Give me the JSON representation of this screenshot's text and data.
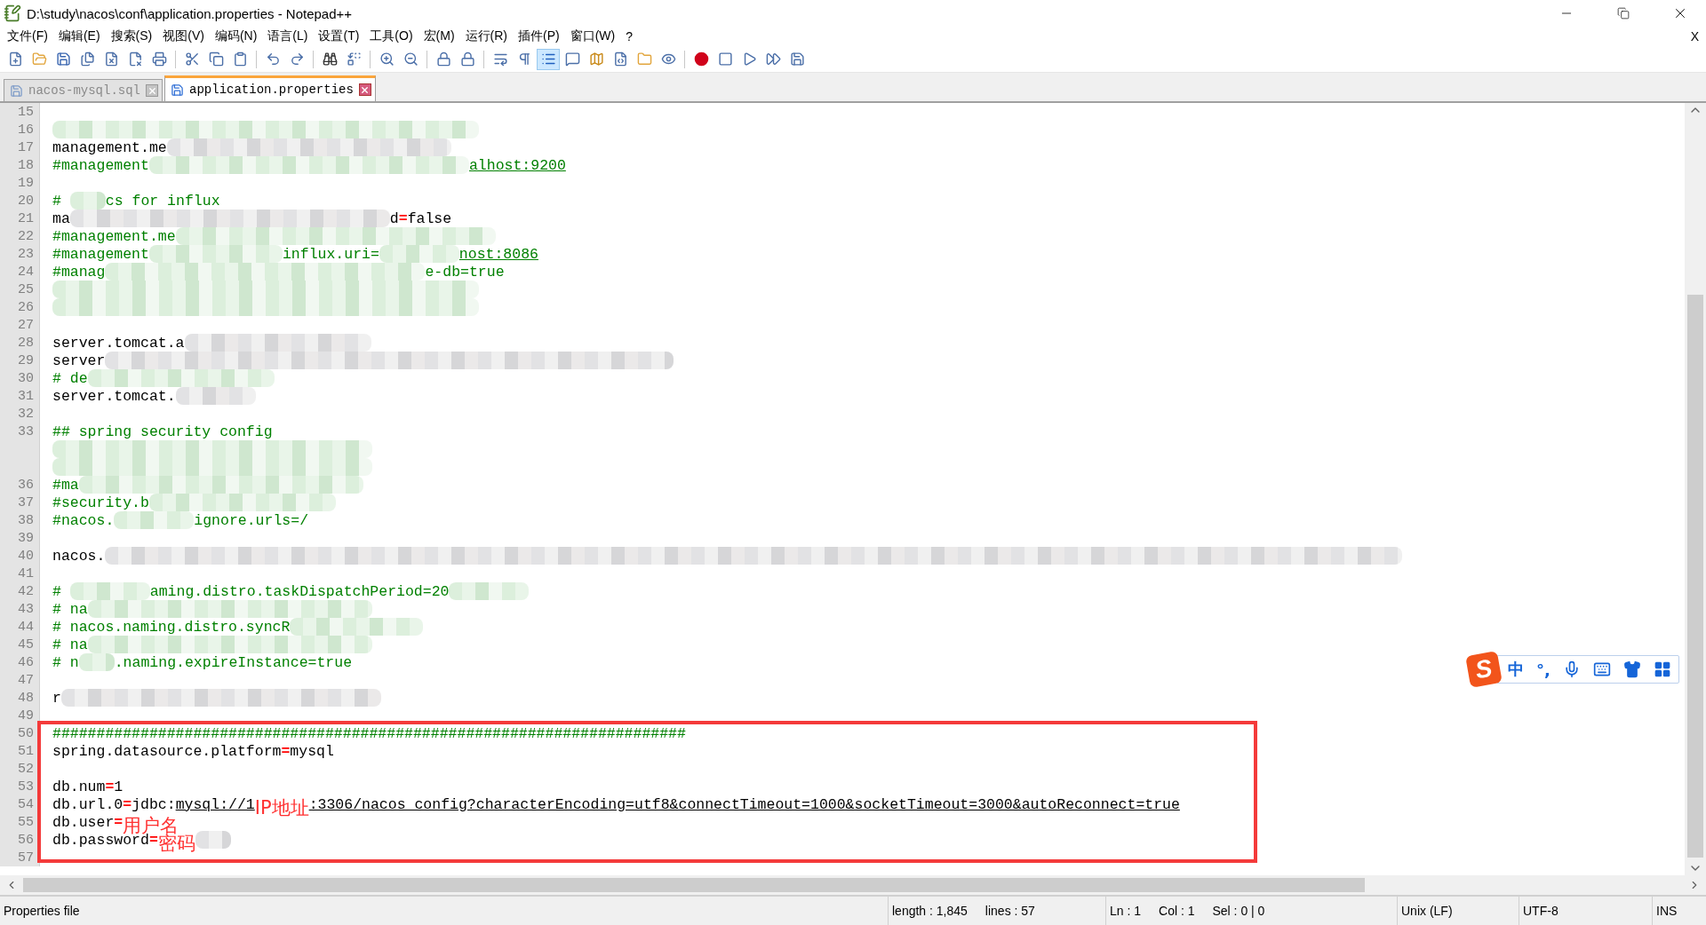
{
  "window": {
    "title": "D:\\study\\nacos\\conf\\application.properties - Notepad++"
  },
  "menu": {
    "items": [
      "文件(F)",
      "编辑(E)",
      "搜索(S)",
      "视图(V)",
      "编码(N)",
      "语言(L)",
      "设置(T)",
      "工具(O)",
      "宏(M)",
      "运行(R)",
      "插件(P)",
      "窗口(W)",
      "?"
    ],
    "close": "X"
  },
  "toolbar": {
    "indent_guide_on": true
  },
  "tabs": [
    {
      "label": "nacos-mysql.sql",
      "selected": false
    },
    {
      "label": "application.properties",
      "selected": true
    }
  ],
  "lines": [
    {
      "number": "15"
    },
    {
      "number": "16",
      "segments": [
        {
          "kind": "blur"
        }
      ]
    },
    {
      "number": "17",
      "segments": [
        {
          "kind": "text",
          "text": "management.me"
        },
        {
          "kind": "blur"
        }
      ]
    },
    {
      "number": "18",
      "segments": [
        {
          "kind": "comment",
          "text": "#management"
        },
        {
          "kind": "blur"
        },
        {
          "kind": "comment-link",
          "text": "alhost:9200"
        }
      ]
    },
    {
      "number": "19"
    },
    {
      "number": "20",
      "segments": [
        {
          "kind": "comment",
          "text": "# "
        },
        {
          "kind": "blur"
        },
        {
          "kind": "comment",
          "text": "cs for influx"
        }
      ]
    },
    {
      "number": "21",
      "segments": [
        {
          "kind": "text",
          "text": "ma"
        },
        {
          "kind": "blur"
        },
        {
          "kind": "text",
          "text": "d"
        },
        {
          "kind": "op",
          "text": "="
        },
        {
          "kind": "text",
          "text": "false"
        }
      ]
    },
    {
      "number": "22",
      "segments": [
        {
          "kind": "comment",
          "text": "#management.me"
        },
        {
          "kind": "blur"
        }
      ]
    },
    {
      "number": "23",
      "segments": [
        {
          "kind": "comment",
          "text": "#management"
        },
        {
          "kind": "blur"
        },
        {
          "kind": "comment",
          "text": "influx.uri="
        },
        {
          "kind": "blur"
        },
        {
          "kind": "comment-link",
          "text": "nost:8086"
        }
      ]
    },
    {
      "number": "24",
      "segments": [
        {
          "kind": "comment",
          "text": "#manag"
        },
        {
          "kind": "blur"
        },
        {
          "kind": "comment",
          "text": "e-db=true"
        }
      ]
    },
    {
      "number": "25",
      "segments": [
        {
          "kind": "blur"
        }
      ]
    },
    {
      "number": "26",
      "segments": [
        {
          "kind": "blur"
        }
      ]
    },
    {
      "number": "27"
    },
    {
      "number": "28",
      "segments": [
        {
          "kind": "text",
          "text": "server.tomcat.a"
        },
        {
          "kind": "blur"
        }
      ]
    },
    {
      "number": "29",
      "segments": [
        {
          "kind": "text",
          "text": "server"
        },
        {
          "kind": "blur"
        }
      ]
    },
    {
      "number": "30",
      "segments": [
        {
          "kind": "comment",
          "text": "# de"
        },
        {
          "kind": "blur"
        }
      ]
    },
    {
      "number": "31",
      "segments": [
        {
          "kind": "text",
          "text": "server.tomcat."
        },
        {
          "kind": "blur"
        }
      ]
    },
    {
      "number": "32"
    },
    {
      "number": "33",
      "segments": [
        {
          "kind": "comment",
          "text": "## spring security config"
        }
      ]
    },
    {
      "segments": [
        {
          "kind": "blur"
        }
      ]
    },
    {
      "segments": [
        {
          "kind": "blur"
        }
      ]
    },
    {
      "number": "36",
      "segments": [
        {
          "kind": "comment",
          "text": "#ma"
        },
        {
          "kind": "blur"
        }
      ]
    },
    {
      "number": "37",
      "segments": [
        {
          "kind": "comment",
          "text": "#security.b"
        },
        {
          "kind": "blur"
        }
      ]
    },
    {
      "number": "38",
      "segments": [
        {
          "kind": "comment",
          "text": "#nacos."
        },
        {
          "kind": "blur"
        },
        {
          "kind": "comment",
          "text": "ignore.urls=/"
        }
      ]
    },
    {
      "number": "39"
    },
    {
      "number": "40",
      "segments": [
        {
          "kind": "text",
          "text": "nacos."
        },
        {
          "kind": "blur"
        }
      ]
    },
    {
      "number": "41"
    },
    {
      "number": "42",
      "segments": [
        {
          "kind": "comment",
          "text": "# "
        },
        {
          "kind": "blur"
        },
        {
          "kind": "comment",
          "text": "aming.distro.taskDispatchPeriod=20"
        },
        {
          "kind": "blur"
        }
      ]
    },
    {
      "number": "43",
      "segments": [
        {
          "kind": "comment",
          "text": "# na"
        },
        {
          "kind": "blur"
        }
      ]
    },
    {
      "number": "44",
      "segments": [
        {
          "kind": "comment",
          "text": "# nacos.naming.distro.syncR"
        },
        {
          "kind": "blur"
        }
      ]
    },
    {
      "number": "45",
      "segments": [
        {
          "kind": "comment",
          "text": "# na"
        },
        {
          "kind": "blur"
        }
      ]
    },
    {
      "number": "46",
      "segments": [
        {
          "kind": "comment",
          "text": "# n"
        },
        {
          "kind": "blur"
        },
        {
          "kind": "comment",
          "text": ".naming.expireInstance=true"
        }
      ]
    },
    {
      "number": "47"
    },
    {
      "number": "48",
      "segments": [
        {
          "kind": "text",
          "text": "r"
        },
        {
          "kind": "blur"
        }
      ]
    },
    {
      "number": "49"
    }
  ],
  "highlighted_lines": [
    {
      "number": "50",
      "segments": [
        {
          "kind": "comment",
          "text": "########################################################################"
        }
      ]
    },
    {
      "number": "51",
      "segments": [
        {
          "kind": "text",
          "text": "spring.datasource.platform"
        },
        {
          "kind": "op",
          "text": "="
        },
        {
          "kind": "text",
          "text": "mysql"
        }
      ]
    },
    {
      "number": "52"
    },
    {
      "number": "53",
      "segments": [
        {
          "kind": "text",
          "text": "db.num"
        },
        {
          "kind": "op",
          "text": "="
        },
        {
          "kind": "text",
          "text": "1"
        }
      ]
    },
    {
      "number": "54",
      "segments": [
        {
          "kind": "text",
          "text": "db.url.0"
        },
        {
          "kind": "op",
          "text": "="
        },
        {
          "kind": "text",
          "text": "jdbc:"
        },
        {
          "kind": "link",
          "text": "mysql://1"
        },
        {
          "kind": "note",
          "text": "IP地址"
        },
        {
          "kind": "link",
          "text": ":3306/nacos_config?characterEncoding=utf8&connectTimeout=1000&socketTimeout=3000&autoReconnect=true"
        }
      ]
    },
    {
      "number": "55",
      "segments": [
        {
          "kind": "text",
          "text": "db.user"
        },
        {
          "kind": "op",
          "text": "="
        },
        {
          "kind": "note",
          "text": "用户名"
        }
      ]
    },
    {
      "number": "56",
      "segments": [
        {
          "kind": "text",
          "text": "db.password"
        },
        {
          "kind": "op",
          "text": "="
        },
        {
          "kind": "note",
          "text": "密码"
        },
        {
          "kind": "blur"
        }
      ]
    },
    {
      "number": "57"
    }
  ],
  "ime": {
    "logo": "S",
    "mode": "中",
    "punct": "°,"
  },
  "status_bar": {
    "file_type": "Properties file",
    "length": "length : 1,845",
    "lines": "lines : 57",
    "ln": "Ln : 1",
    "col": "Col : 1",
    "sel": "Sel : 0 | 0",
    "eol": "Unix (LF)",
    "encoding": "UTF-8",
    "mode": "INS"
  }
}
